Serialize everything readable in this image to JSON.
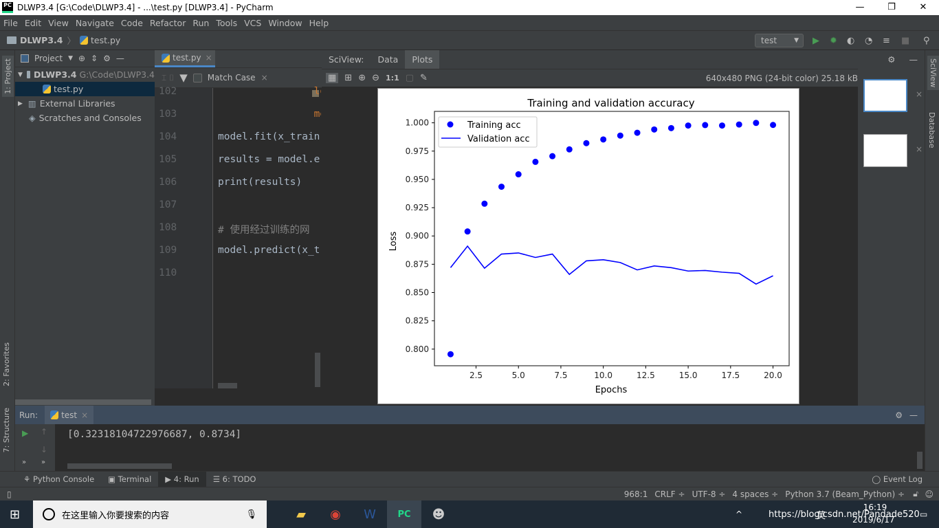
{
  "window": {
    "title": "DLWP3.4 [G:\\Code\\DLWP3.4] - ...\\test.py [DLWP3.4] - PyCharm",
    "logo": "PC",
    "minimize": "—",
    "maximize": "❐",
    "close": "✕"
  },
  "menu": [
    "File",
    "Edit",
    "View",
    "Navigate",
    "Code",
    "Refactor",
    "Run",
    "Tools",
    "VCS",
    "Window",
    "Help"
  ],
  "breadcrumb": {
    "project": "DLWP3.4",
    "file": "test.py"
  },
  "run_config": "test",
  "project_panel": {
    "title": "Project",
    "root": "DLWP3.4",
    "root_path": "G:\\Code\\DLWP3.4",
    "items": [
      "test.py",
      "External Libraries",
      "Scratches and Consoles"
    ]
  },
  "left_stripe": {
    "project": "1: Project",
    "favorites": "2: Favorites",
    "structure": "7: Structure"
  },
  "editor": {
    "tab": "test.py",
    "match_case": "Match Case",
    "lines": [
      {
        "n": "102",
        "code": "                los"
      },
      {
        "n": "103",
        "code": "                met"
      },
      {
        "n": "104",
        "code": "model.fit(x_train"
      },
      {
        "n": "105",
        "code": "results = model.e"
      },
      {
        "n": "106",
        "code": "print(results)"
      },
      {
        "n": "107",
        "code": ""
      },
      {
        "n": "108",
        "code": "# 使用经过训练的网"
      },
      {
        "n": "109",
        "code": "model.predict(x_t"
      },
      {
        "n": "110",
        "code": ""
      }
    ]
  },
  "sciview": {
    "label": "SciView:",
    "tabs": [
      "Data",
      "Plots"
    ],
    "active_tab": "Plots",
    "zoom_actual": "1:1",
    "image_info": "640x480 PNG (24-bit color) 25.18 kB"
  },
  "right_stripe": {
    "sciview": "SciView",
    "database": "Database"
  },
  "run": {
    "label": "Run:",
    "tab": "test",
    "output": "[0.32318104722976687, 0.8734]"
  },
  "bottom_tabs": [
    "Python Console",
    "Terminal",
    "4: Run",
    "6: TODO"
  ],
  "event_log": "Event Log",
  "status": {
    "position": "968:1",
    "line_sep": "CRLF ÷",
    "encoding": "UTF-8 ÷",
    "indent": "4 spaces ÷",
    "interpreter": "Python 3.7 (Beam_Python) ÷"
  },
  "taskbar": {
    "search_placeholder": "在这里输入你要搜索的内容",
    "time": "16:19",
    "date": "2019/6/17",
    "ime": "英",
    "watermark": "https://blog.csdn.net/Pandade520"
  },
  "colors": {
    "series": "#0000ff",
    "accent": "#4a88c7",
    "run_green": "#499c54"
  },
  "chart_data": {
    "type": "line",
    "title": "Training and validation accuracy",
    "xlabel": "Epochs",
    "ylabel": "Loss",
    "xlim": [
      0.05,
      20.95
    ],
    "ylim": [
      0.7853,
      1.0101
    ],
    "xticks": [
      "2.5",
      "5.0",
      "7.5",
      "10.0",
      "12.5",
      "15.0",
      "17.5",
      "20.0"
    ],
    "yticks": [
      "0.800",
      "0.825",
      "0.850",
      "0.875",
      "0.900",
      "0.925",
      "0.950",
      "0.975",
      "1.000"
    ],
    "legend": "top-left",
    "grid": false,
    "x": [
      1,
      2,
      3,
      4,
      5,
      6,
      7,
      8,
      9,
      10,
      11,
      12,
      13,
      14,
      15,
      16,
      17,
      18,
      19,
      20
    ],
    "series": [
      {
        "name": "Training acc",
        "style": "dots",
        "color": "#0000ff",
        "values": [
          0.7955,
          0.904,
          0.9285,
          0.9435,
          0.9545,
          0.9655,
          0.9705,
          0.9765,
          0.982,
          0.9853,
          0.9887,
          0.9912,
          0.9941,
          0.9953,
          0.9976,
          0.998,
          0.9976,
          0.9985,
          0.9999,
          0.9981
        ]
      },
      {
        "name": "Validation acc",
        "style": "line",
        "color": "#0000ff",
        "values": [
          0.872,
          0.891,
          0.8715,
          0.884,
          0.885,
          0.881,
          0.884,
          0.866,
          0.878,
          0.879,
          0.8765,
          0.87,
          0.8735,
          0.872,
          0.869,
          0.8695,
          0.868,
          0.867,
          0.8575,
          0.8648
        ]
      }
    ]
  }
}
